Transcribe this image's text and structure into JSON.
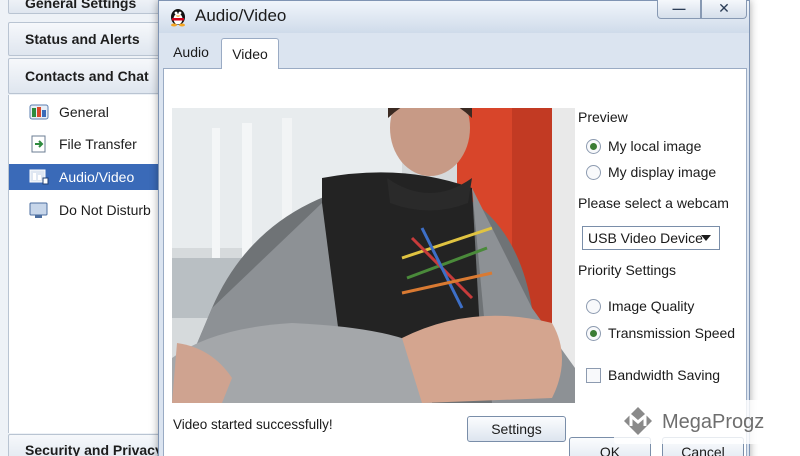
{
  "background_window": {
    "headers": {
      "general_settings": "General Settings",
      "status_alerts": "Status and Alerts",
      "contacts_chat": "Contacts and Chat",
      "security": "Security and Privacy"
    },
    "items": [
      {
        "label": "General",
        "icon": "general-settings-icon",
        "selected": false
      },
      {
        "label": "File Transfer",
        "icon": "file-transfer-icon",
        "selected": false
      },
      {
        "label": "Audio/Video",
        "icon": "audio-video-icon",
        "selected": true
      },
      {
        "label": "Do Not Disturb",
        "icon": "do-not-disturb-icon",
        "selected": false
      }
    ]
  },
  "dialog": {
    "title": "Audio/Video",
    "title_icon": "penguin-icon",
    "min_label": "—",
    "close_label": "✕",
    "tabs": [
      {
        "label": "Audio",
        "active": false
      },
      {
        "label": "Video",
        "active": true
      }
    ],
    "preview": {
      "heading": "Preview",
      "options": [
        {
          "label": "My local image",
          "checked": true
        },
        {
          "label": "My display image",
          "checked": false
        }
      ]
    },
    "webcam": {
      "heading": "Please select a webcam",
      "selected": "USB Video Device"
    },
    "priority": {
      "heading": "Priority Settings",
      "options": [
        {
          "label": "Image Quality",
          "checked": false
        },
        {
          "label": "Transmission Speed",
          "checked": true
        }
      ]
    },
    "bandwidth_saving": {
      "label": "Bandwidth Saving",
      "checked": false
    },
    "status": "Video started successfully!",
    "settings_button": "Settings",
    "ok_button": "OK",
    "cancel_button": "Cancel"
  },
  "watermark": {
    "text": "MegaProgz",
    "icon": "megaprogz-logo-icon"
  },
  "colors": {
    "selection": "#3a6ab8",
    "radio_dot": "#3b7c34",
    "dialog_bg": "#dbe4f0"
  }
}
